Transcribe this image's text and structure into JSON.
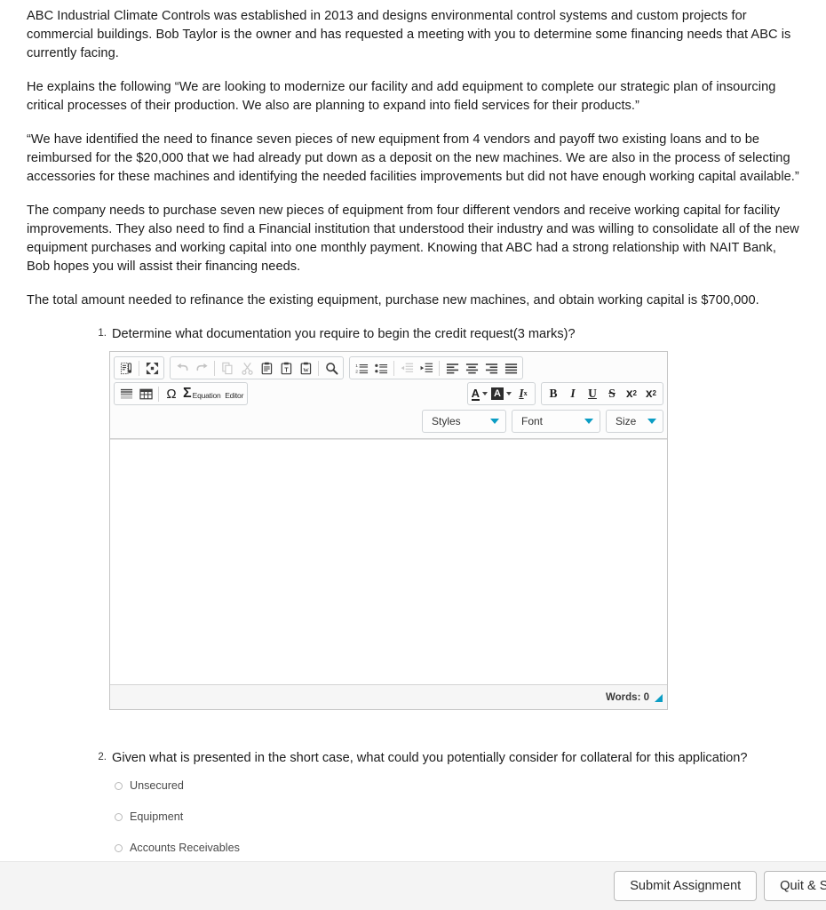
{
  "case": {
    "paragraphs": [
      "ABC Industrial Climate Controls was established in 2013 and designs environmental control systems and custom projects for commercial buildings. Bob Taylor is the owner and has requested a meeting with you to determine some financing needs that ABC is currently facing.",
      "He explains the following “We are looking to modernize our facility and add equipment to complete our strategic plan of insourcing critical processes of their production. We also are planning to expand into field services for their products.”",
      "“We have identified the need to finance seven pieces of new equipment from 4 vendors and payoff two existing loans and to be reimbursed for the $20,000 that we had already put down as a deposit on the new machines. We are also in the process of selecting accessories for these machines and identifying the needed facilities improvements but did not have enough working capital available.”",
      "The company needs to purchase seven new pieces of equipment from four different vendors and receive working capital for facility improvements. They also need to find a Financial institution that understood their industry and was willing to consolidate all of the new equipment purchases and working capital into one monthly payment. Knowing that ABC had a strong relationship with NAIT Bank, Bob hopes you will assist their financing needs.",
      "The total amount needed to refinance the existing equipment, purchase new machines, and obtain working capital is $700,000."
    ]
  },
  "question1": {
    "number": "1.",
    "text": "Determine what documentation you require to begin the credit request(3 marks)?",
    "editor": {
      "toolbar_row1": [
        {
          "name": "source-icon",
          "title": "Source"
        },
        {
          "name": "maximize-icon",
          "title": "Maximize"
        },
        {
          "name": "undo-icon",
          "title": "Undo",
          "disabled": true
        },
        {
          "name": "redo-icon",
          "title": "Redo",
          "disabled": true
        },
        {
          "name": "copy-icon",
          "title": "Copy",
          "disabled": true
        },
        {
          "name": "cut-icon",
          "title": "Cut",
          "disabled": true
        },
        {
          "name": "paste-icon",
          "title": "Paste"
        },
        {
          "name": "paste-as-text-icon",
          "title": "Paste as plain text"
        },
        {
          "name": "paste-from-word-icon",
          "title": "Paste from Word"
        },
        {
          "name": "find-icon",
          "title": "Find"
        },
        {
          "name": "numbered-list-icon",
          "title": "Insert/Remove Numbered List"
        },
        {
          "name": "bulleted-list-icon",
          "title": "Insert/Remove Bulleted List"
        },
        {
          "name": "outdent-icon",
          "title": "Decrease Indent",
          "disabled": true
        },
        {
          "name": "indent-icon",
          "title": "Increase Indent"
        },
        {
          "name": "align-left-icon",
          "title": "Align Left"
        },
        {
          "name": "align-center-icon",
          "title": "Center"
        },
        {
          "name": "align-right-icon",
          "title": "Align Right"
        },
        {
          "name": "align-justify-icon",
          "title": "Justify"
        }
      ],
      "toolbar_row2": [
        {
          "name": "blockquote-icon",
          "title": "Block Quote"
        },
        {
          "name": "table-icon",
          "title": "Table"
        },
        {
          "name": "special-character-icon",
          "title": "Insert Special Character",
          "glyph": "Ω"
        },
        {
          "name": "equation-editor-icon",
          "title": "Equation Editor",
          "glyph": "Σ",
          "label_line1": "Equation",
          "label_line2": "Editor"
        },
        {
          "name": "text-color-icon",
          "title": "Text Color",
          "glyph": "A"
        },
        {
          "name": "background-color-icon",
          "title": "Background Color",
          "glyph": "A"
        },
        {
          "name": "remove-format-icon",
          "title": "Remove Format",
          "glyph": "I",
          "sub": "x"
        },
        {
          "name": "bold-icon",
          "title": "Bold",
          "glyph": "B"
        },
        {
          "name": "italic-icon",
          "title": "Italic",
          "glyph": "I"
        },
        {
          "name": "underline-icon",
          "title": "Underline",
          "glyph": "U"
        },
        {
          "name": "strikethrough-icon",
          "title": "Strikethrough",
          "glyph": "S"
        },
        {
          "name": "subscript-icon",
          "title": "Subscript",
          "glyph": "x",
          "sub": "2"
        },
        {
          "name": "superscript-icon",
          "title": "Superscript",
          "glyph": "x",
          "sup": "2"
        }
      ],
      "dropdowns": {
        "styles": "Styles",
        "font": "Font",
        "size": "Size"
      },
      "content": "",
      "status": {
        "words_label": "Words: 0"
      },
      "accent_color": "#0b9dc4"
    }
  },
  "question2": {
    "number": "2.",
    "text": "Given what is presented in the short case, what could you potentially consider for collateral for this application?",
    "options": [
      {
        "label": "Unsecured",
        "selected": false
      },
      {
        "label": "Equipment",
        "selected": false
      },
      {
        "label": "Accounts Receivables",
        "selected": false
      }
    ]
  },
  "footer": {
    "submit_label": "Submit Assignment",
    "quit_label": "Quit & Save"
  }
}
